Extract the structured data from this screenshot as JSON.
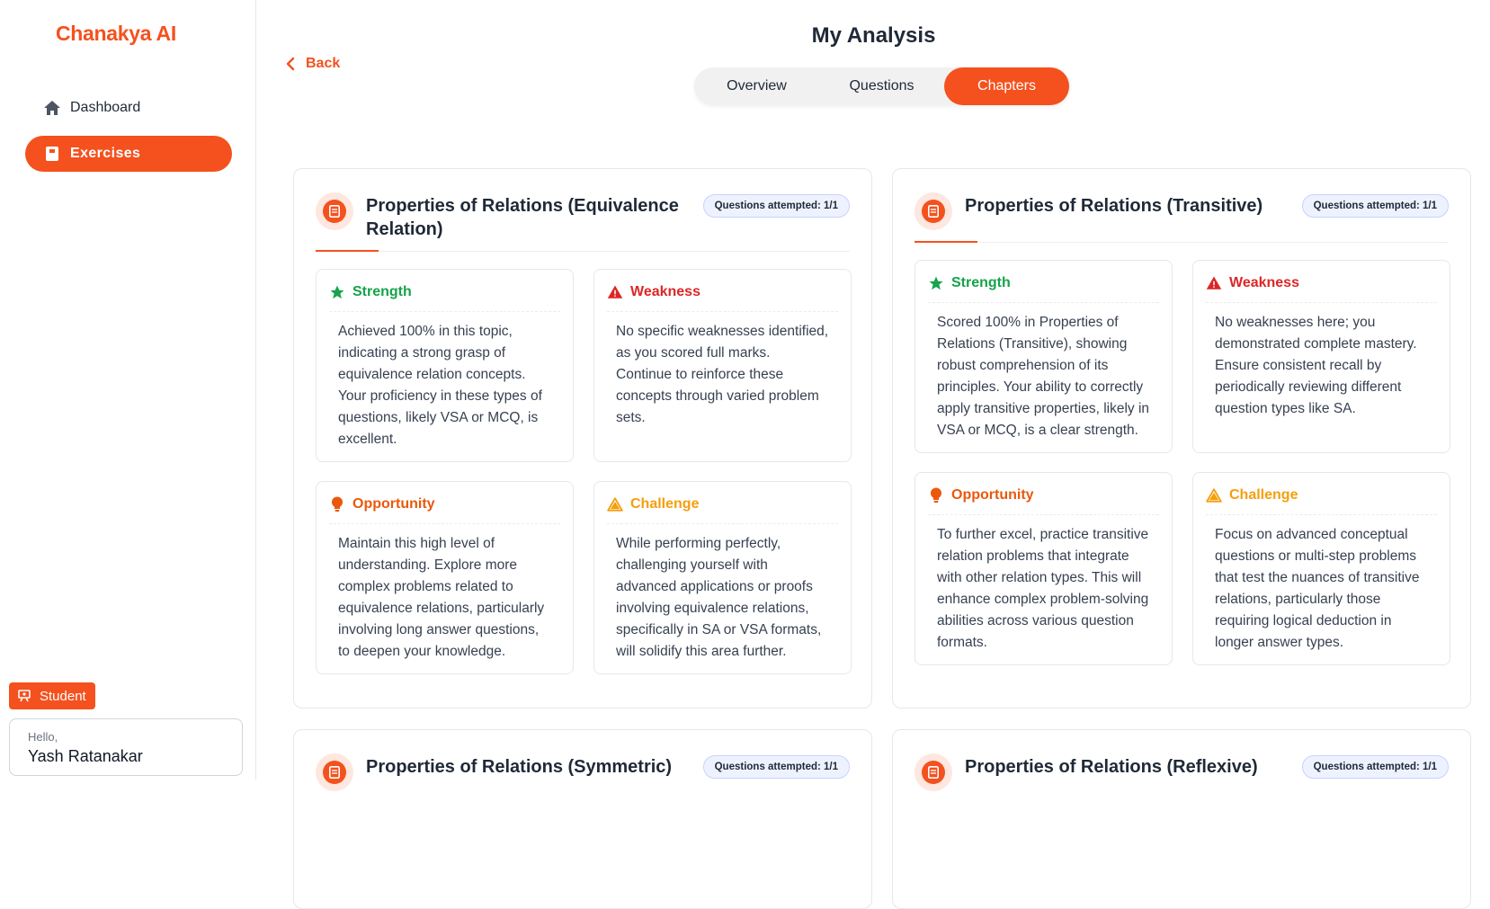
{
  "sidebar": {
    "logo": "Chanakya AI",
    "items": [
      {
        "label": "Dashboard",
        "icon": "home-icon"
      },
      {
        "label": "Exercises",
        "icon": "book-icon"
      }
    ],
    "role": "Student",
    "user": {
      "greeting": "Hello,",
      "name": "Yash Ratanakar"
    }
  },
  "header": {
    "title": "My Analysis",
    "back": "Back",
    "tabs": [
      "Overview",
      "Questions",
      "Chapters"
    ],
    "active_tab": "Chapters"
  },
  "colors": {
    "accent": "#f4511e",
    "strength": "#16a34a",
    "weakness": "#dc2626",
    "opportunity": "#ea580c",
    "challenge": "#f59e0b"
  },
  "chapters": [
    {
      "title": "Properties of Relations (Equivalence Relation)",
      "attempted": "Questions attempted: 1/1",
      "strength": {
        "label": "Strength",
        "text": "Achieved 100% in this topic, indicating a strong grasp of equivalence relation concepts. Your proficiency in these types of questions, likely VSA or MCQ, is excellent."
      },
      "weakness": {
        "label": "Weakness",
        "text": "No specific weaknesses identified, as you scored full marks. Continue to reinforce these concepts through varied problem sets."
      },
      "opportunity": {
        "label": "Opportunity",
        "text": "Maintain this high level of understanding. Explore more complex problems related to equivalence relations, particularly involving long answer questions, to deepen your knowledge."
      },
      "challenge": {
        "label": "Challenge",
        "text": "While performing perfectly, challenging yourself with advanced applications or proofs involving equivalence relations, specifically in SA or VSA formats, will solidify this area further."
      }
    },
    {
      "title": "Properties of Relations (Transitive)",
      "attempted": "Questions attempted: 1/1",
      "strength": {
        "label": "Strength",
        "text": "Scored 100% in Properties of Relations (Transitive), showing robust comprehension of its principles. Your ability to correctly apply transitive properties, likely in VSA or MCQ, is a clear strength."
      },
      "weakness": {
        "label": "Weakness",
        "text": "No weaknesses here; you demonstrated complete mastery. Ensure consistent recall by periodically reviewing different question types like SA."
      },
      "opportunity": {
        "label": "Opportunity",
        "text": "To further excel, practice transitive relation problems that integrate with other relation types. This will enhance complex problem-solving abilities across various question formats."
      },
      "challenge": {
        "label": "Challenge",
        "text": "Focus on advanced conceptual questions or multi-step problems that test the nuances of transitive relations, particularly those requiring logical deduction in longer answer types."
      }
    },
    {
      "title": "Properties of Relations (Symmetric)",
      "attempted": "Questions attempted: 1/1"
    },
    {
      "title": "Properties of Relations (Reflexive)",
      "attempted": "Questions attempted: 1/1"
    }
  ]
}
